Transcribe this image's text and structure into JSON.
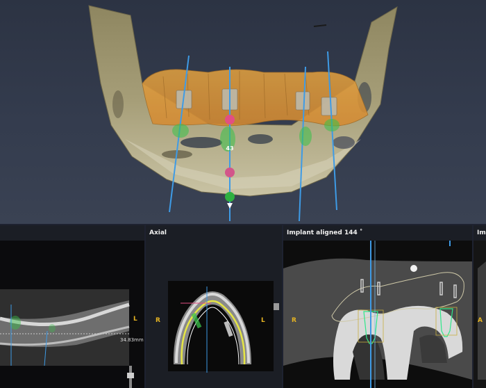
{
  "view3d": {
    "implant_label": "43"
  },
  "panels": [
    {
      "id": "cross",
      "title": "",
      "orientation_right": "L"
    },
    {
      "id": "axial",
      "title": "Axial",
      "orientation_left": "R",
      "orientation_right": "L",
      "measurement": "34.83mm"
    },
    {
      "id": "aligned",
      "title": "Implant aligned 144 ˚",
      "orientation_left": "R"
    },
    {
      "id": "extra",
      "title": "Imp",
      "orientation_left": "A"
    }
  ],
  "colors": {
    "implant_axis": "#3e9be6",
    "implant_marker_green": "#3ac24a",
    "implant_marker_pink": "#e24f83",
    "orientation_label": "#e6b422",
    "nerve_canal": "#e6e644",
    "implant_outline": "#2ee88a"
  }
}
